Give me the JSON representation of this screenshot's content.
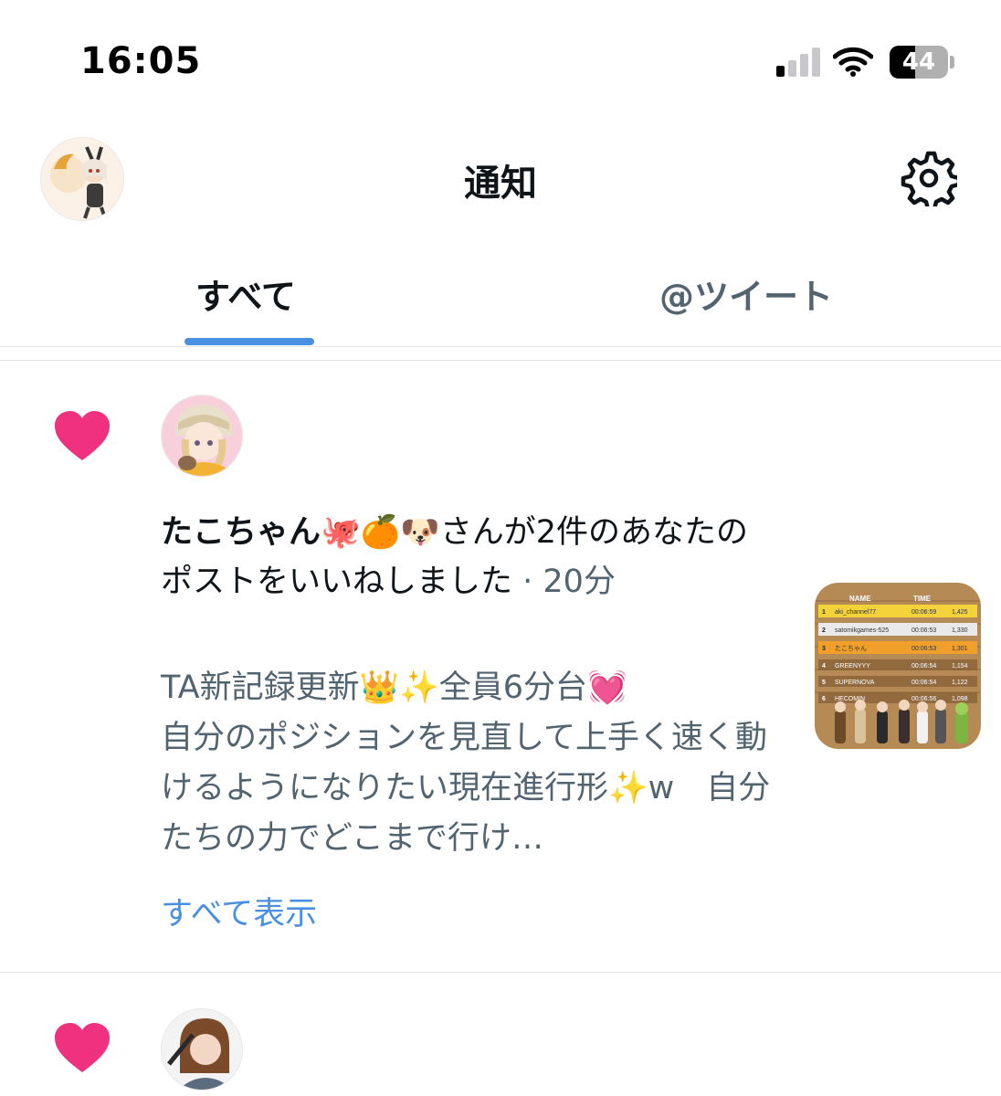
{
  "status_bar": {
    "time": "16:05",
    "battery_level": "44",
    "battery_fraction": 0.44,
    "signal_bars_on": 1,
    "signal_bars_total": 4
  },
  "header": {
    "title": "通知",
    "avatar_icon": "user-avatar",
    "settings_icon": "gear-icon"
  },
  "tabs": [
    {
      "label": "すべて",
      "active": true
    },
    {
      "label": "@ツイート",
      "active": false
    }
  ],
  "notifications": [
    {
      "type_icon": "heart-icon",
      "user_name": "たこちゃん🐙🍊🐶",
      "action_text": "さんが2件のあなたのポストをいいねしました",
      "separator": " · ",
      "time": "20分",
      "post_excerpt": "TA新記録更新👑✨全員6分台💓\n自分のポジションを見直して上手く速く動けるようになりたい現在進行形✨w　自分たちの力でどこまで行け…",
      "show_all": "すべて表示",
      "thumbnail": {
        "headers": [
          "NAME",
          "TIME"
        ],
        "rows": [
          {
            "rank": "1",
            "name": "aki_channel77",
            "time": "00:06:59",
            "extra": "1,425"
          },
          {
            "rank": "2",
            "name": "satomikgames-525",
            "time": "00:06:53",
            "extra": "1,330"
          },
          {
            "rank": "3",
            "name": "たこちゃん",
            "time": "00:06:53",
            "extra": "1,301"
          },
          {
            "rank": "4",
            "name": "GREENYYY",
            "time": "00:06:54",
            "extra": "1,154"
          },
          {
            "rank": "5",
            "name": "SUPERNOVA",
            "time": "00:06:54",
            "extra": "1,122"
          },
          {
            "rank": "6",
            "name": "HECOMIN",
            "time": "00:06:56",
            "extra": "1,098"
          }
        ]
      }
    },
    {
      "type_icon": "heart-icon"
    }
  ],
  "colors": {
    "accent": "#4a90e2",
    "heart": "#f0317f",
    "secondary_text": "#536471",
    "primary_text": "#0f1419",
    "divider": "#e1e5e8"
  }
}
